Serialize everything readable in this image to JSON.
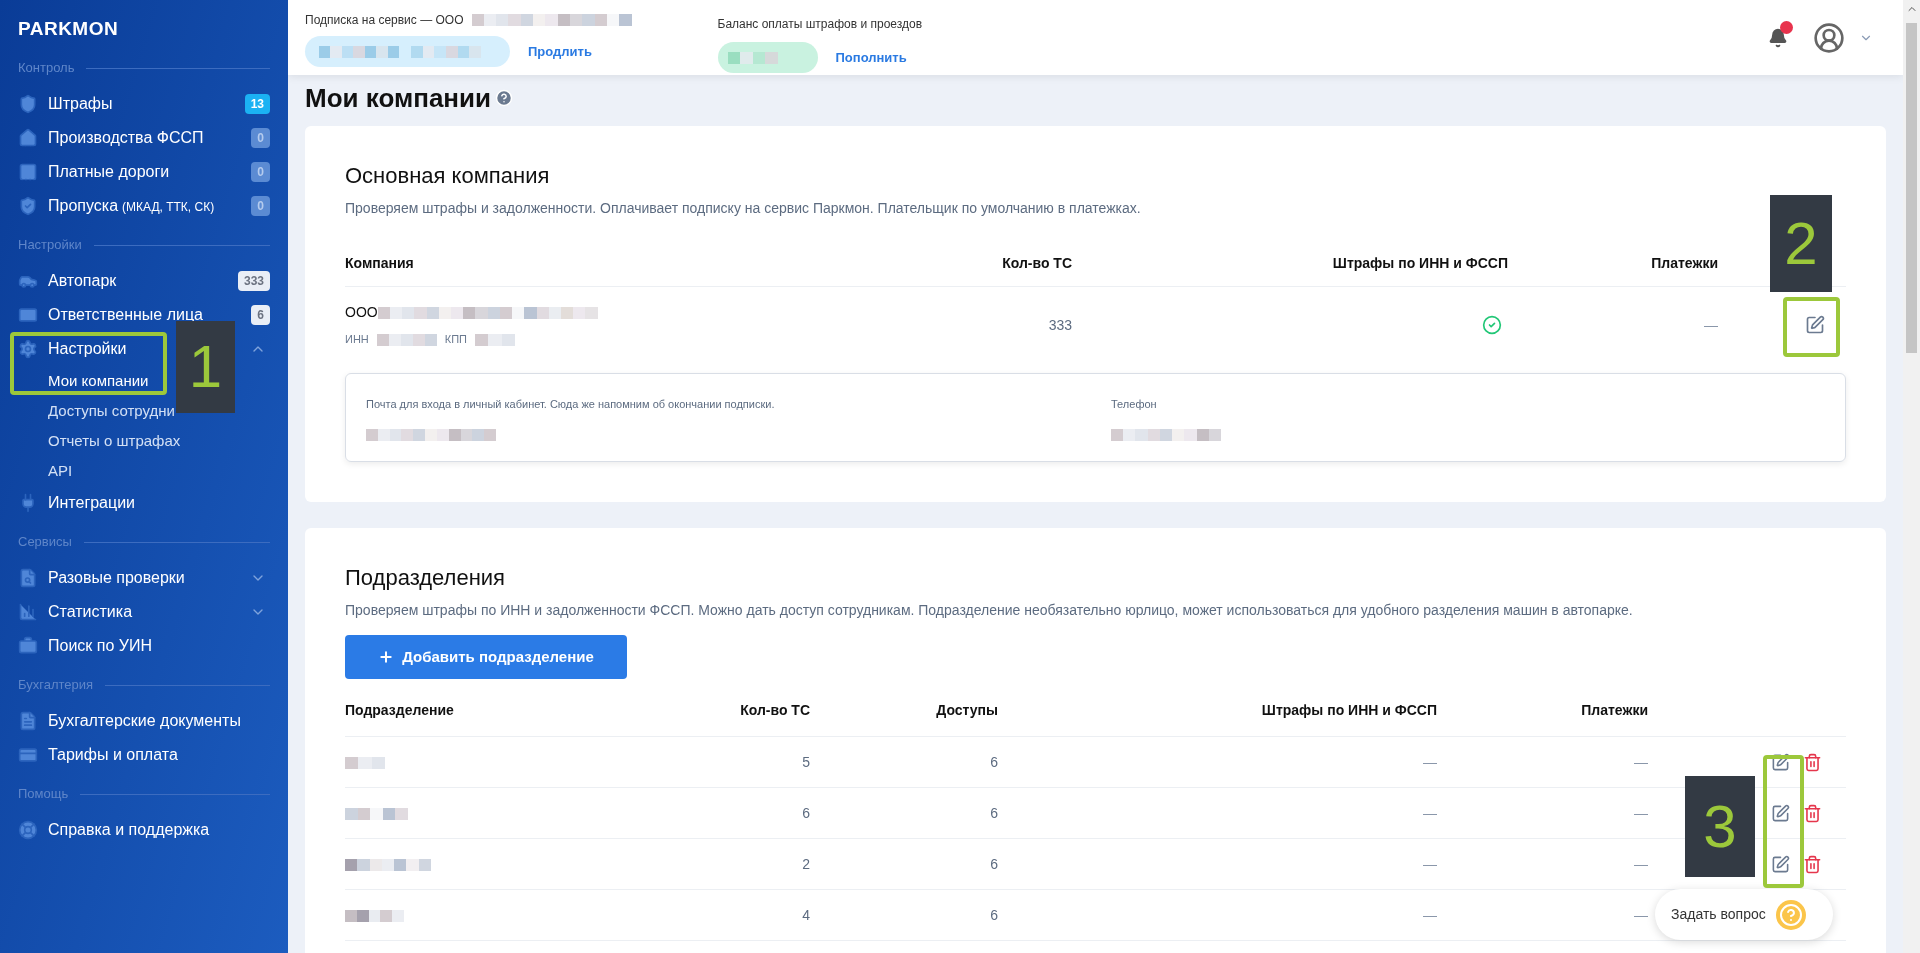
{
  "sidebar": {
    "logo": "PARKMON",
    "sections": [
      {
        "title": "Контроль",
        "items": [
          {
            "label": "Штрафы",
            "badge": "13",
            "color": "#1bb2f3"
          },
          {
            "label": "Производства ФССП",
            "badge": "0",
            "color": "#5b8bd3"
          },
          {
            "label": "Платные дороги",
            "badge": "0",
            "color": "#5b8bd3"
          },
          {
            "label": "Пропуска",
            "note": "(МКАД, ТТК, СК)",
            "badge": "0",
            "color": "#5b8bd3"
          }
        ]
      },
      {
        "title": "Настройки",
        "items": [
          {
            "label": "Автопарк",
            "badge": "333",
            "color": "#e9eef6"
          },
          {
            "label": "Ответственные лица",
            "badge": "6",
            "color": "#e9eef6"
          },
          {
            "label": "Настройки",
            "expanded": true,
            "children": [
              {
                "label": "Мои компании",
                "selected": true
              },
              {
                "label": "Доступы сотрудни",
                "selected": false
              },
              {
                "label": "Отчеты о штрафах",
                "selected": false
              },
              {
                "label": "API",
                "selected": false
              }
            ]
          },
          {
            "label": "Интеграции"
          }
        ]
      },
      {
        "title": "Сервисы",
        "items": [
          {
            "label": "Разовые проверки",
            "expanded": false
          },
          {
            "label": "Статистика",
            "expanded": false
          },
          {
            "label": "Поиск по УИН"
          }
        ]
      },
      {
        "title": "Бухгалтерия",
        "items": [
          {
            "label": "Бухгалтерские документы"
          },
          {
            "label": "Тарифы и оплата"
          }
        ]
      },
      {
        "title": "Помощь",
        "items": [
          {
            "label": "Справка и поддержка"
          }
        ]
      }
    ]
  },
  "topbar": {
    "subscription_label": "Подписка на сервис — ООО",
    "subscription_action": "Продлить",
    "balance_label": "Баланс оплаты штрафов и проездов",
    "balance_action": "Пополнить",
    "has_notifications": true
  },
  "page_title": "Мои компании",
  "main_company": {
    "title": "Основная компания",
    "description": "Проверяем штрафы и задолженности. Оплачивает подписку на сервис Паркмон. Плательщик по умолчанию в платежках.",
    "columns": [
      "Компания",
      "Кол-во ТС",
      "Штрафы по ИНН и ФССП",
      "Платежки"
    ],
    "row": {
      "name_prefix": "ООО",
      "inn_label": "ИНН",
      "kpp_label": "КПП",
      "vehicles": "333",
      "fines_check": true,
      "payments": "—"
    },
    "contacts": {
      "email_label": "Почта для входа в личный кабинет. Сюда же напомним об окончании подписки.",
      "phone_label": "Телефон"
    }
  },
  "divisions": {
    "title": "Подразделения",
    "description": "Проверяем штрафы по ИНН и задолженности ФССП. Можно дать доступ сотрудникам. Подразделение необязательно юрлицо, может использоваться для удобного разделения машин в автопарке.",
    "add_button": "Добавить подразделение",
    "columns": [
      "Подразделение",
      "Кол-во ТС",
      "Доступы",
      "Штрафы по ИНН и ФССП",
      "Платежки"
    ],
    "rows": [
      {
        "vehicles": "5",
        "access": "6",
        "fines": "—",
        "payments": "—"
      },
      {
        "vehicles": "6",
        "access": "6",
        "fines": "—",
        "payments": "—"
      },
      {
        "vehicles": "2",
        "access": "6",
        "fines": "—",
        "payments": "—"
      },
      {
        "vehicles": "4",
        "access": "6",
        "fines": "—",
        "payments": "—"
      }
    ]
  },
  "chat": {
    "label": "Задать вопрос"
  },
  "annotations": [
    {
      "number": "1"
    },
    {
      "number": "2"
    },
    {
      "number": "3"
    }
  ]
}
